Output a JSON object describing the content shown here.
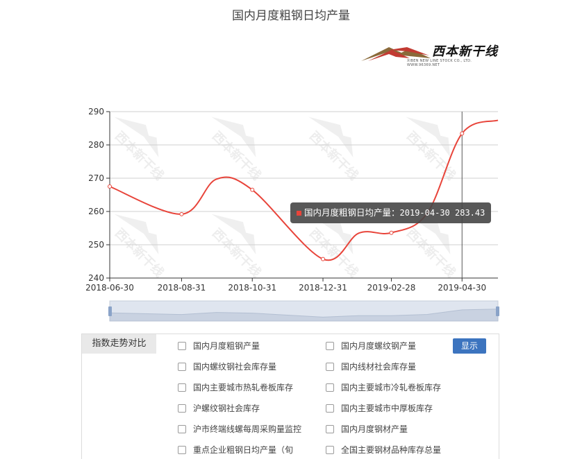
{
  "page": {
    "title": "国内月度粗钢日均产量"
  },
  "logo": {
    "brand": "西本新干线",
    "sub": "XIBEN NEW LINE STOCK CO., LTD.   WWW.96369.NET"
  },
  "watermark": "西本新干线",
  "chart_data": {
    "type": "line",
    "title": "国内月度粗钢日均产量",
    "ylim": [
      240,
      290
    ],
    "yticks": [
      240,
      250,
      260,
      270,
      280,
      290
    ],
    "xlim": [
      "2018-06-30",
      "2019-05-31"
    ],
    "xticks": [
      "2018-06-30",
      "2018-08-31",
      "2018-10-31",
      "2018-12-31",
      "2019-02-28",
      "2019-04-30"
    ],
    "grid": true,
    "series": [
      {
        "name": "国内月度粗钢日均产量",
        "color": "#e8443a",
        "points": [
          {
            "x": "2018-06-30",
            "y": 267.5
          },
          {
            "x": "2018-08-31",
            "y": 259.2
          },
          {
            "x": "2018-09-30",
            "y": 269.7
          },
          {
            "x": "2018-10-31",
            "y": 266.5
          },
          {
            "x": "2018-12-31",
            "y": 245.7
          },
          {
            "x": "2019-01-31",
            "y": 253.5
          },
          {
            "x": "2019-02-28",
            "y": 253.6
          },
          {
            "x": "2019-03-31",
            "y": 259.5
          },
          {
            "x": "2019-04-30",
            "y": 283.43
          },
          {
            "x": "2019-05-31",
            "y": 287.4
          }
        ]
      }
    ],
    "highlight": {
      "x": "2019-04-30",
      "y": 283.43
    }
  },
  "tooltip": {
    "series_name": "国内月度粗钢日均产量：",
    "date": "2019-04-30",
    "value": "283.43"
  },
  "compare": {
    "tab_label": "指数走势对比",
    "show_label": "显示",
    "options": [
      "国内月度粗钢产量",
      "国内月度螺纹钢产量",
      "国内螺纹钢社会库存量",
      "国内线材社会库存量",
      "国内主要城市热轧卷板库存",
      "国内主要城市冷轧卷板库存",
      "沪螺纹钢社会库存",
      "国内主要城市中厚板库存",
      "沪市终端线螺每周采购量监控",
      "国内月度钢材产量",
      "重点企业粗钢日均产量（旬",
      "全国主要钢材品种库存总量"
    ]
  }
}
